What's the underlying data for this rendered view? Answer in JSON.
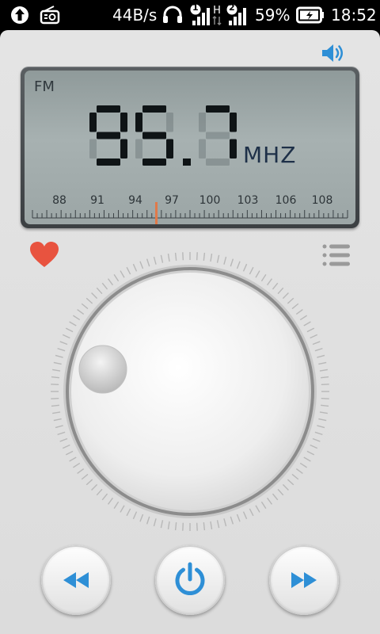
{
  "status_bar": {
    "network_speed": "44B/s",
    "sim1_badge": "1",
    "sim2_badge": "2",
    "network_type": "H",
    "battery_percent": "59%",
    "time": "18:52"
  },
  "lcd": {
    "band": "FM",
    "frequency": "95.7",
    "unit": "MHZ",
    "scale_labels": [
      "88",
      "91",
      "94",
      "97",
      "100",
      "103",
      "106",
      "108"
    ]
  },
  "colors": {
    "accent": "#2e8fd6",
    "favorite": "#e8533f",
    "needle": "#e07a4a",
    "lcd_digit": "#0f1416",
    "lcd_unit": "#1e3048"
  },
  "icons": {
    "upload": "upload-icon",
    "radio": "radio-icon",
    "headset": "headset-icon",
    "signal": "signal-icon",
    "battery": "battery-charging-icon",
    "speaker": "speaker-icon",
    "favorite": "heart-icon",
    "list": "list-icon",
    "seek_back": "rewind-icon",
    "power": "power-icon",
    "seek_forward": "fast-forward-icon"
  }
}
